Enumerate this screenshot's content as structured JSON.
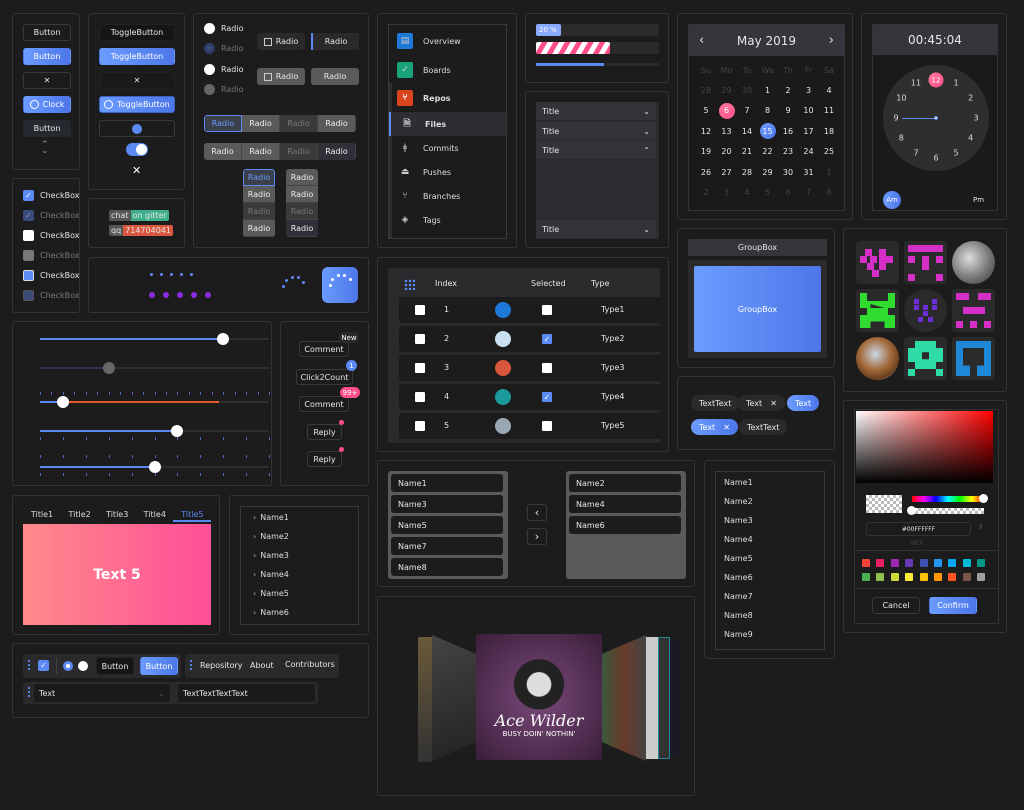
{
  "buttons": {
    "button1": "Button",
    "button2": "Button",
    "close": "✕",
    "clock": "Clock",
    "button3": "Button",
    "toggle1": "ToggleButton",
    "toggle2": "ToggleButton",
    "toggle_close": "✕",
    "toggle_clock": "ToggleButton",
    "toggle_close2": "✕"
  },
  "checkboxes": [
    {
      "label": "CheckBox",
      "state": "checked"
    },
    {
      "label": "CheckBox",
      "state": "checked-disabled"
    },
    {
      "label": "CheckBox",
      "state": "unchecked"
    },
    {
      "label": "CheckBox",
      "state": "unchecked-disabled"
    },
    {
      "label": "CheckBox",
      "state": "indeterminate"
    },
    {
      "label": "CheckBox",
      "state": "indeterminate-disabled"
    }
  ],
  "shields": [
    {
      "subject": "chat",
      "status": "on gitter",
      "color": "#3fae8c"
    },
    {
      "subject": "qq",
      "status": "714704041",
      "color": "#d9573f"
    }
  ],
  "radios": {
    "items": [
      {
        "label": "Radio",
        "state": "unchecked"
      },
      {
        "label": "Radio",
        "state": "checked-disabled"
      },
      {
        "label": "Radio",
        "state": "unchecked"
      },
      {
        "label": "Radio",
        "state": "disabled"
      }
    ],
    "icon_buttons": [
      "Radio",
      "Radio",
      "Radio",
      "Radio"
    ],
    "segment_row1": [
      "Radio",
      "Radio",
      "Radio",
      "Radio"
    ],
    "segment_row2": [
      "Radio",
      "Radio",
      "Radio",
      "Radio"
    ],
    "vertical1": [
      "Radio",
      "Radio",
      "Radio",
      "Radio"
    ],
    "vertical2": [
      "Radio",
      "Radio",
      "Radio",
      "Radio"
    ]
  },
  "side_menu": {
    "items": [
      {
        "label": "Overview",
        "icon": "overview-icon"
      },
      {
        "label": "Boards",
        "icon": "boards-icon"
      },
      {
        "label": "Repos",
        "icon": "repos-icon"
      },
      {
        "label": "Files",
        "icon": "file-icon"
      },
      {
        "label": "Commits",
        "icon": "commit-icon"
      },
      {
        "label": "Pushes",
        "icon": "push-icon"
      },
      {
        "label": "Branches",
        "icon": "branch-icon"
      },
      {
        "label": "Tags",
        "icon": "tag-icon"
      }
    ],
    "selected": "Files"
  },
  "progress": {
    "bar1_label": "20 %",
    "bar1_value": 20,
    "bar2_value": 60,
    "bar3_value": 55
  },
  "accordion": {
    "items": [
      {
        "title": "Title",
        "expanded": false
      },
      {
        "title": "Title",
        "expanded": false
      },
      {
        "title": "Title",
        "expanded": true
      },
      {
        "title": "Title",
        "expanded": false
      }
    ]
  },
  "calendar": {
    "month_label": "May 2019",
    "weekdays": [
      "Su",
      "Mo",
      "Tu",
      "We",
      "Th",
      "Fr",
      "Sa"
    ],
    "weeks": [
      [
        "28",
        "29",
        "30",
        "1",
        "2",
        "3",
        "4"
      ],
      [
        "5",
        "6",
        "7",
        "8",
        "9",
        "10",
        "11"
      ],
      [
        "12",
        "13",
        "14",
        "15",
        "16",
        "17",
        "18"
      ],
      [
        "19",
        "20",
        "21",
        "22",
        "23",
        "24",
        "25"
      ],
      [
        "26",
        "27",
        "28",
        "29",
        "30",
        "31",
        "1"
      ],
      [
        "2",
        "3",
        "4",
        "5",
        "6",
        "7",
        "8"
      ]
    ],
    "today": "6",
    "selected": "15"
  },
  "clock": {
    "time": "00:45:04",
    "numbers": [
      "12",
      "1",
      "2",
      "3",
      "4",
      "5",
      "6",
      "7",
      "8",
      "9",
      "10",
      "11"
    ],
    "highlighted_hour": "12",
    "am_label": "Am",
    "pm_label": "Pm",
    "selected_period": "Am"
  },
  "sliders": [
    {
      "value": 80
    },
    {
      "value": 30,
      "disabled": true
    },
    {
      "range_start": 10,
      "range_end": 78
    },
    {
      "value": 60
    },
    {
      "value": 50
    }
  ],
  "badges": [
    {
      "label": "Comment",
      "badge": "New"
    },
    {
      "label": "Click2Count",
      "badge": "1"
    },
    {
      "label": "Comment",
      "badge": "99+"
    },
    {
      "label": "Reply",
      "badge": "dot"
    },
    {
      "label": "Reply",
      "badge": "dot"
    }
  ],
  "tabs": {
    "items": [
      "Title1",
      "Title2",
      "Title3",
      "Title4",
      "Title5"
    ],
    "selected": "Title5",
    "content": "Text 5"
  },
  "tree": {
    "items": [
      "Name1",
      "Name2",
      "Name3",
      "Name4",
      "Name5",
      "Name6"
    ]
  },
  "toolbar": {
    "button1": "Button",
    "button2": "Button",
    "links": [
      "Repository",
      "About",
      "Contributors"
    ],
    "combo_value": "Text",
    "textbox_value": "TextTextTextText"
  },
  "datagrid": {
    "columns": [
      "Index",
      "Selected",
      "Type"
    ],
    "rows": [
      {
        "index": "1",
        "selected": false,
        "type": "Type1"
      },
      {
        "index": "2",
        "selected": true,
        "type": "Type2"
      },
      {
        "index": "3",
        "selected": false,
        "type": "Type3"
      },
      {
        "index": "4",
        "selected": true,
        "type": "Type4"
      },
      {
        "index": "5",
        "selected": false,
        "type": "Type5"
      }
    ]
  },
  "transfer": {
    "left": [
      "Name1",
      "Name3",
      "Name5",
      "Name7",
      "Name8"
    ],
    "right": [
      "Name2",
      "Name4",
      "Name6"
    ]
  },
  "listbox": {
    "items": [
      "Name1",
      "Name2",
      "Name3",
      "Name4",
      "Name5",
      "Name6",
      "Name7",
      "Name8",
      "Name9"
    ]
  },
  "groupbox": {
    "header": "GroupBox",
    "content": "GroupBox"
  },
  "tags": [
    {
      "label": "TextText",
      "closable": false,
      "selected": false
    },
    {
      "label": "Text",
      "closable": true,
      "selected": false
    },
    {
      "label": "Text",
      "closable": false,
      "selected": true
    },
    {
      "label": "Text",
      "closable": true,
      "selected": true
    },
    {
      "label": "TextText",
      "closable": false,
      "selected": false
    }
  ],
  "colorpicker": {
    "hex_value": "#00FFFFFF",
    "hex_label": "HEX",
    "swatches": [
      "#f44336",
      "#e91e63",
      "#9c27b0",
      "#673ab7",
      "#3f51b5",
      "#2196f3",
      "#03a9f4",
      "#00bcd4",
      "#009688",
      "#4caf50",
      "#8bc34a",
      "#cddc39",
      "#ffeb3b",
      "#ffc107",
      "#ff9800",
      "#ff5722",
      "#795548",
      "#9e9e9e"
    ],
    "cancel_label": "Cancel",
    "confirm_label": "Confirm"
  },
  "coverflow": {
    "album_title": "Ace Wilder",
    "album_subtitle": "BUSY DOIN' NOTHIN'"
  },
  "colors": {
    "accent": "#5b8af5",
    "pink": "#ff4f8b",
    "danger": "#e0582b",
    "purple": "#8a2be2"
  }
}
